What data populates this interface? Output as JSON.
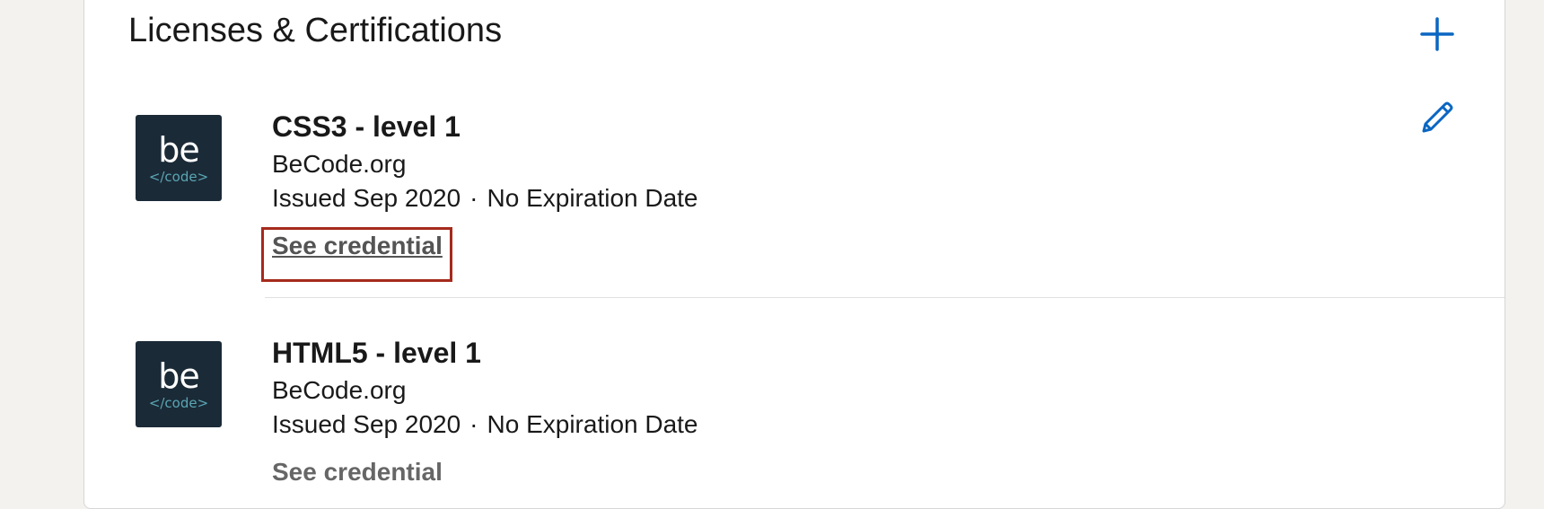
{
  "section": {
    "title": "Licenses & Certifications",
    "add_icon": "plus-icon",
    "edit_icon": "pencil-icon"
  },
  "certifications": [
    {
      "logo_text": "be",
      "logo_subtext": "</code>",
      "title": "CSS3 - level 1",
      "organization": "BeCode.org",
      "issued": "Issued Sep 2020",
      "separator": "·",
      "expiration": "No Expiration Date",
      "link": "See credential"
    },
    {
      "logo_text": "be",
      "logo_subtext": "</code>",
      "title": "HTML5 - level 1",
      "organization": "BeCode.org",
      "issued": "Issued Sep 2020",
      "separator": "·",
      "expiration": "No Expiration Date",
      "link": "See credential"
    }
  ],
  "colors": {
    "accent": "#0a66c2",
    "highlight": "#a52a1c",
    "logo_bg": "#1b2a37",
    "logo_code": "#5aa6b4"
  }
}
